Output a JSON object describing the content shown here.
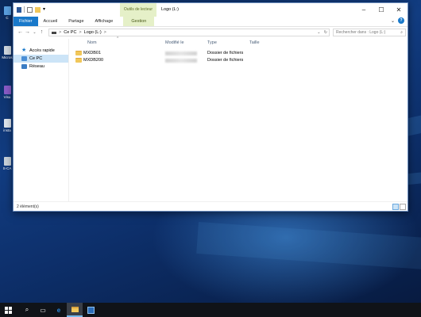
{
  "desktop": {
    "icons": [
      {
        "label": "C"
      },
      {
        "label": "Micros"
      },
      {
        "label": "Visu"
      },
      {
        "label": "insta"
      },
      {
        "label": "S-CA"
      }
    ]
  },
  "window": {
    "title": "Logo (L:)",
    "context_group": "Outils de lecteur",
    "ribbon_tabs": [
      "Fichier",
      "Accueil",
      "Partage",
      "Affichage"
    ],
    "context_tab": "Gestion",
    "help_label": "?",
    "address": {
      "segments": [
        "Ce PC",
        "Logo (L:)"
      ],
      "separator": ">"
    },
    "search_placeholder": "Rechercher dans : Logo (L:)",
    "nav_pane": [
      {
        "label": "Accès rapide",
        "icon": "star-icon",
        "selected": false
      },
      {
        "label": "Ce PC",
        "icon": "computer-icon",
        "selected": true
      },
      {
        "label": "Réseau",
        "icon": "network-icon",
        "selected": false
      }
    ],
    "columns": {
      "name": "Nom",
      "modified": "Modifié le",
      "type": "Type",
      "size": "Taille"
    },
    "files": [
      {
        "name": "MXDB01",
        "type": "Dossier de fichiers",
        "size": ""
      },
      {
        "name": "MXDB200",
        "type": "Dossier de fichiers",
        "size": ""
      }
    ],
    "status_text": "2 élément(s)"
  },
  "colors": {
    "accent": "#1979ca",
    "context_tab_bg": "#e5f0c8",
    "selection": "#cce4f7",
    "folder": "#f1c75a"
  }
}
